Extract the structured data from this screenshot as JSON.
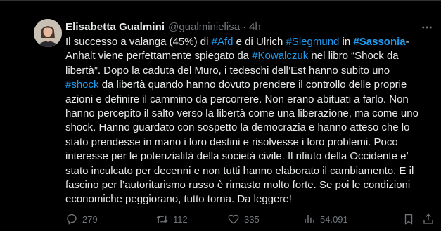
{
  "colors": {
    "background": "#000000",
    "text": "#e7e9ea",
    "muted": "#71767b",
    "link": "#1d9bf0"
  },
  "tweet": {
    "author": {
      "display_name": "Elisabetta Gualmini",
      "handle": "@gualminielisa",
      "separator": "·",
      "time": "4h",
      "avatar_icon": "profile-photo"
    },
    "more_icon": "ellipsis-icon",
    "text": {
      "l1": {
        "a": "Il successo a valanga (45%) di ",
        "tag1": "#Afd",
        "b": " e di Ulrich ",
        "tag2": "#Siegmund",
        "c": " in ",
        "tag3": "#Sassonia",
        "d": "-"
      },
      "l2": {
        "a": "Anhalt viene perfettamente  spiegato da  ",
        "tag1": "#Kowalczuk",
        "b": " nel libro “Shock da"
      },
      "l3": "libertà”. Dopo la caduta del Muro, i tedeschi dell’Est hanno subito uno",
      "l4": {
        "tag1": "#shock",
        "a": " da libertà quando hanno dovuto prendere il controllo delle proprie"
      },
      "l5": "azioni e definire il cammino da percorrere. Non erano abituati a farlo. Non",
      "l6": "hanno percepito il salto verso la libertà come una liberazione, ma come uno",
      "l7": "shock. Hanno guardato con sospetto la democrazia e hanno atteso che lo",
      "l8": "stato prendesse in mano i loro destini e risolvesse i loro problemi. Poco",
      "l9": "interesse per le potenzialità della società civile. Il rifiuto della Occidente e’",
      "l10": "stato inculcato per decenni  e non tutti hanno elaborato il cambiamento. E il",
      "l11": "fascino per l’autoritarismo russo è rimasto molto forte. Se poi le condizioni",
      "l12": "economiche peggiorano, tutto torna. Da leggere!"
    },
    "actions": {
      "reply": {
        "icon": "reply-icon",
        "count": "279"
      },
      "retweet": {
        "icon": "retweet-icon",
        "count": "112"
      },
      "like": {
        "icon": "heart-icon",
        "count": "335"
      },
      "views": {
        "icon": "views-icon",
        "count": "54.091"
      },
      "bookmark": {
        "icon": "bookmark-icon"
      },
      "share": {
        "icon": "share-icon"
      }
    }
  }
}
